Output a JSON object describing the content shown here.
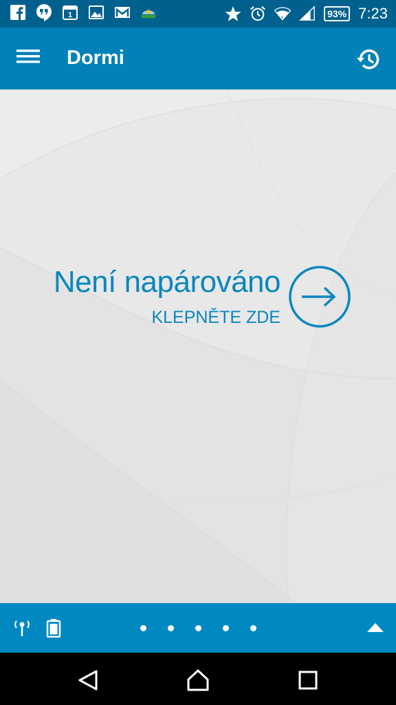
{
  "status_bar": {
    "notification_icons": [
      "facebook-icon",
      "hangouts-icon",
      "calendar-icon",
      "gallery-icon",
      "gmail-icon",
      "weather-icon"
    ],
    "calendar_day": "1",
    "system_icons": [
      "star-icon",
      "alarm-icon",
      "wifi-icon",
      "signal-icon"
    ],
    "battery_percent": "93%",
    "time": "7:23"
  },
  "app_bar": {
    "title": "Dormi",
    "menu_icon": "hamburger-menu-icon",
    "history_icon": "history-icon"
  },
  "main": {
    "pair_status": "Není napárováno",
    "pair_action": "KLEPNĚTE ZDE",
    "arrow_icon": "arrow-right-circle-icon"
  },
  "bottom_bar": {
    "left_icons": [
      "antenna-icon",
      "battery-icon"
    ],
    "page_dots": 5,
    "expand_icon": "triangle-up-icon"
  },
  "nav_bar": {
    "buttons": [
      "back-icon",
      "home-icon",
      "recents-icon"
    ]
  },
  "colors": {
    "status_bar": "#00618f",
    "app_bar": "#0081b8",
    "bottom_bar": "#0089c1",
    "accent_text": "#0b86bf",
    "background": "#e8e8e8"
  }
}
